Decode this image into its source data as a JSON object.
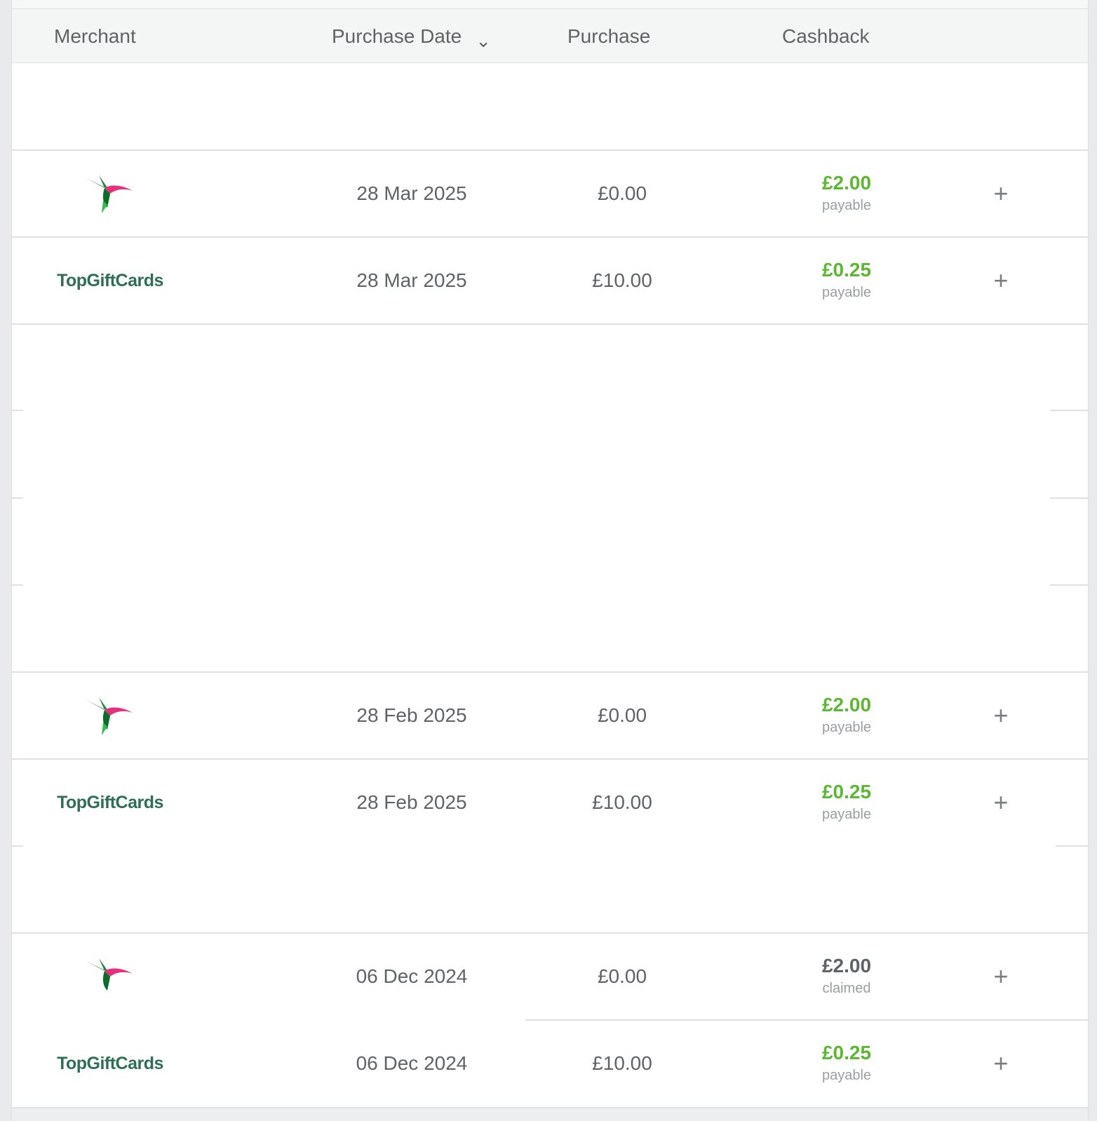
{
  "table": {
    "columns": {
      "merchant": "Merchant",
      "purchase_date": "Purchase Date",
      "purchase": "Purchase",
      "cashback": "Cashback"
    },
    "sort_icon": "chevron-down-icon",
    "expand_icon": "plus-icon",
    "rows": [
      {
        "merchant_logo": "hummingbird-logo",
        "date": "28 Mar 2025",
        "purchase": "£0.00",
        "cashback": "£2.00",
        "status": "payable",
        "status_color": "#5cb833"
      },
      {
        "merchant_logo": "topgiftcards-logo",
        "merchant_text": "TopGiftCards",
        "date": "28 Mar 2025",
        "purchase": "£10.00",
        "cashback": "£0.25",
        "status": "payable",
        "status_color": "#5cb833"
      },
      {
        "merchant_logo": "hummingbird-logo",
        "date": "28 Feb 2025",
        "purchase": "£0.00",
        "cashback": "£2.00",
        "status": "payable",
        "status_color": "#5cb833"
      },
      {
        "merchant_logo": "topgiftcards-logo",
        "merchant_text": "TopGiftCards",
        "date": "28 Feb 2025",
        "purchase": "£10.00",
        "cashback": "£0.25",
        "status": "payable",
        "status_color": "#5cb833"
      },
      {
        "merchant_logo": "hummingbird-logo",
        "date": "06 Dec 2024",
        "purchase": "£0.00",
        "cashback": "£2.00",
        "status": "claimed",
        "status_color": "#5f6366"
      },
      {
        "merchant_logo": "topgiftcards-logo",
        "merchant_text": "TopGiftCards",
        "date": "06 Dec 2024",
        "purchase": "£10.00",
        "cashback": "£0.25",
        "status": "payable",
        "status_color": "#5cb833"
      }
    ],
    "expand_symbol": "+"
  }
}
